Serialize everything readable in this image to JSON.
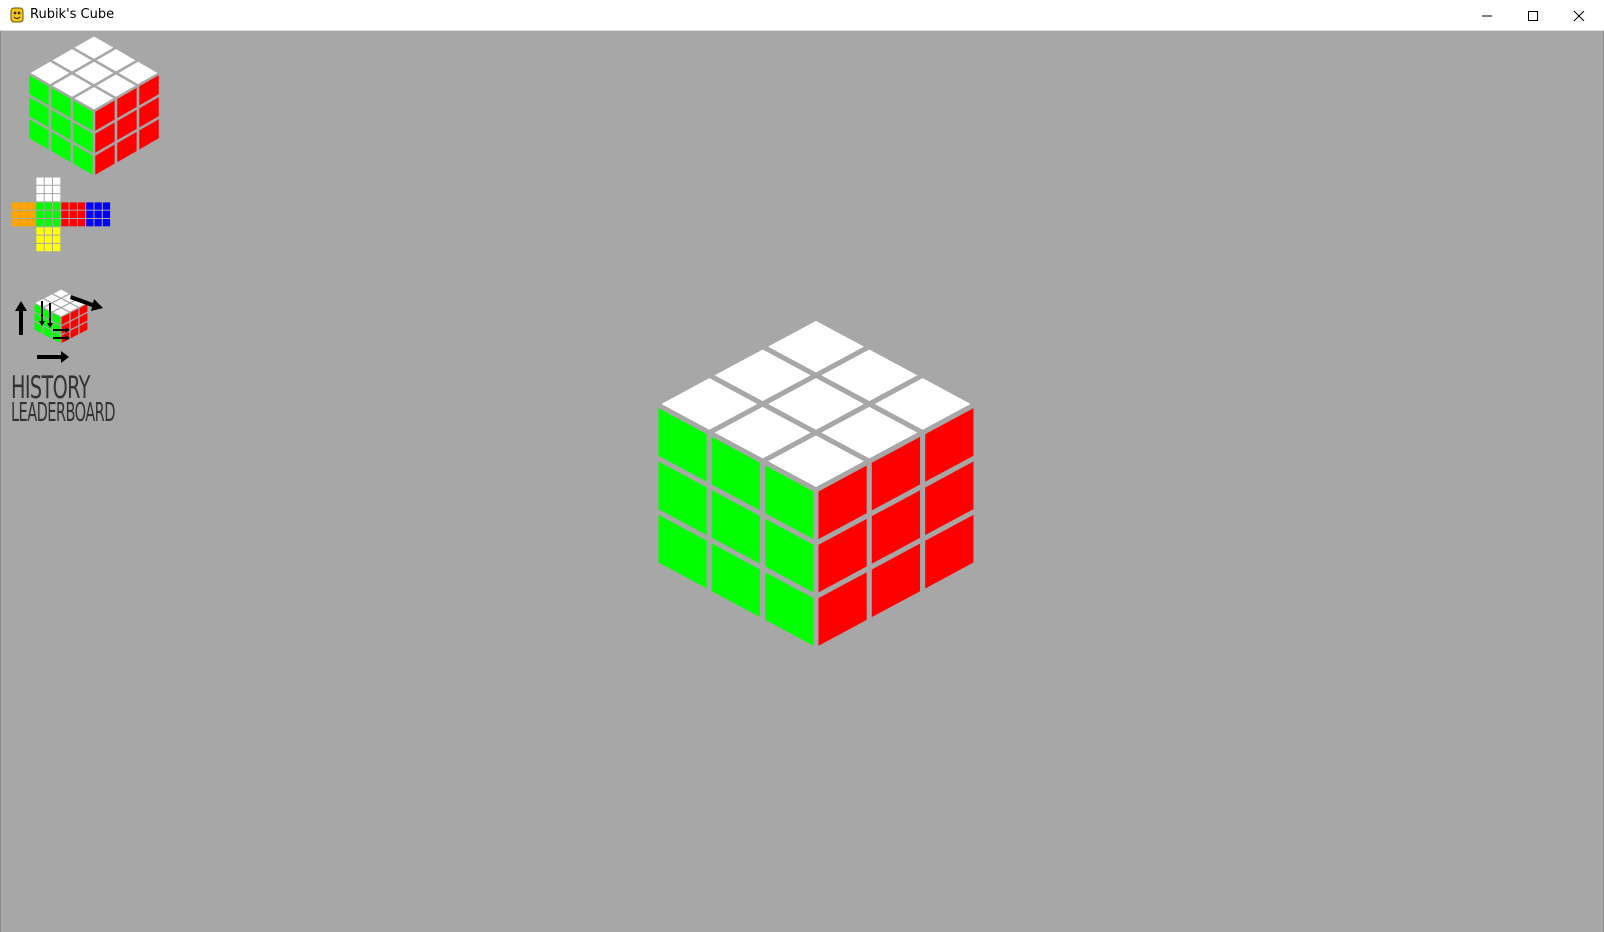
{
  "window": {
    "title": "Rubik's Cube",
    "app_icon": "python-icon",
    "controls": [
      "minimize-icon",
      "maximize-icon",
      "close-icon"
    ]
  },
  "colors": {
    "background": "#a7a7a7",
    "white": "#ffffff",
    "green": "#00ff00",
    "red": "#ff0000",
    "blue": "#0000ff",
    "orange": "#ffa500",
    "yellow": "#ffff00",
    "gap": "#a7a7a7"
  },
  "cube_state": {
    "up": "white",
    "front": "green",
    "right": "red",
    "left": "orange",
    "back": "blue",
    "down": "yellow"
  },
  "sidebar": {
    "preview": "cube-preview",
    "net": "cube-net",
    "controls_icon": "rotate-arrows-icon",
    "history_label": "HISTORY",
    "leaderboard_label": "LEADERBOARD"
  }
}
